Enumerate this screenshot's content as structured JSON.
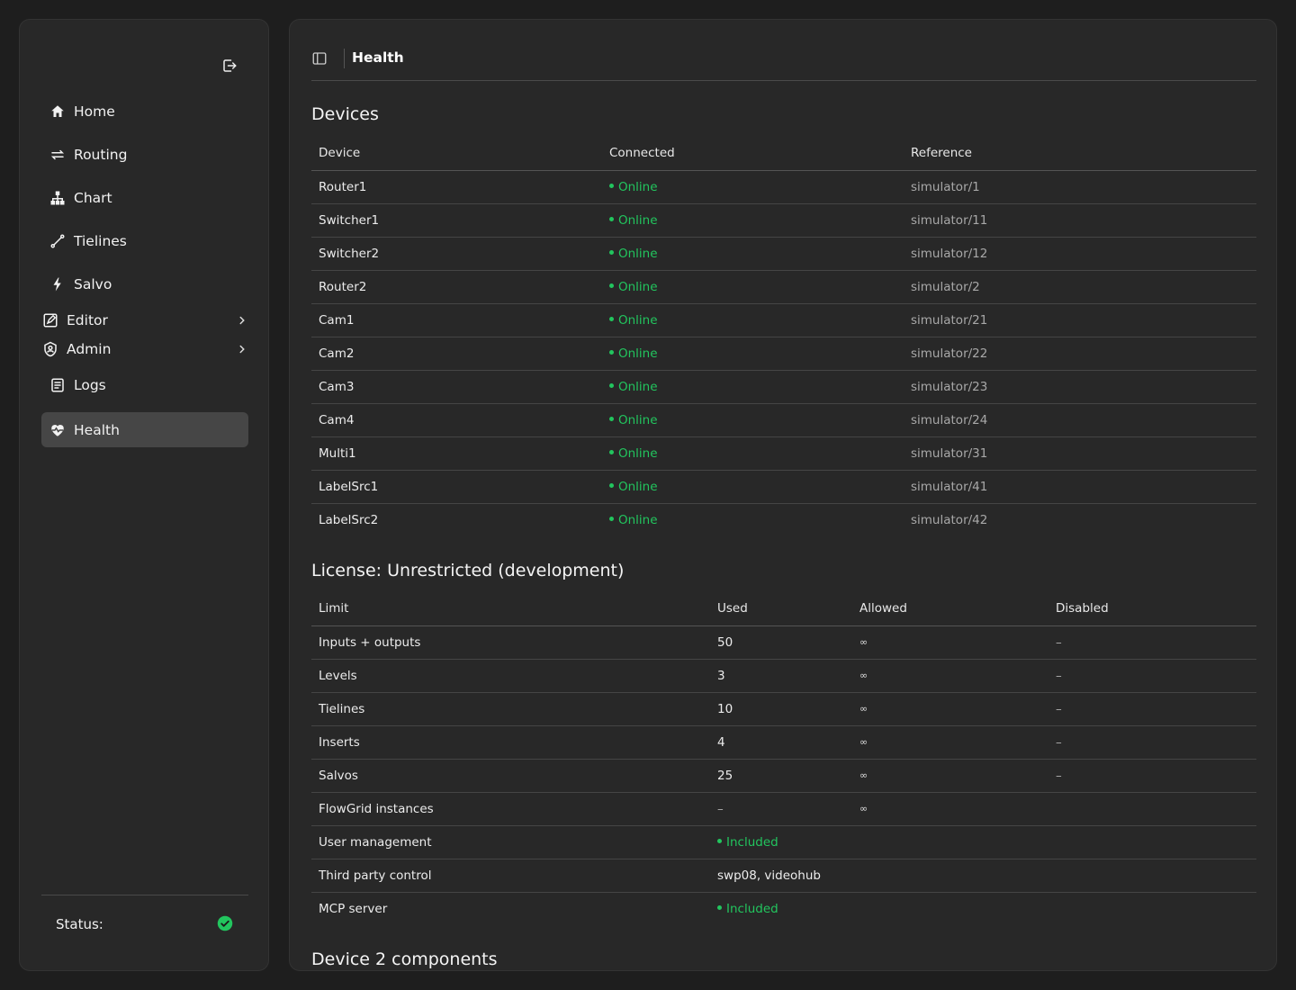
{
  "sidebar": {
    "items": [
      {
        "label": "Home",
        "icon": "home-icon"
      },
      {
        "label": "Routing",
        "icon": "arrows-icon"
      },
      {
        "label": "Chart",
        "icon": "hierarchy-icon"
      },
      {
        "label": "Tielines",
        "icon": "link-icon"
      },
      {
        "label": "Salvo",
        "icon": "lightning-icon"
      },
      {
        "label": "Editor",
        "icon": "edit-icon"
      },
      {
        "label": "Admin",
        "icon": "shield-icon"
      },
      {
        "label": "Logs",
        "icon": "list-icon"
      },
      {
        "label": "Health",
        "icon": "heart-pulse-icon"
      }
    ],
    "active": "Health",
    "status_label": "Status:",
    "status_color": "#22c55e"
  },
  "header": {
    "title": "Health"
  },
  "devices": {
    "title": "Devices",
    "columns": [
      "Device",
      "Connected",
      "Reference"
    ],
    "rows": [
      {
        "device": "Router1",
        "connected": "Online",
        "reference": "simulator/1"
      },
      {
        "device": "Switcher1",
        "connected": "Online",
        "reference": "simulator/11"
      },
      {
        "device": "Switcher2",
        "connected": "Online",
        "reference": "simulator/12"
      },
      {
        "device": "Router2",
        "connected": "Online",
        "reference": "simulator/2"
      },
      {
        "device": "Cam1",
        "connected": "Online",
        "reference": "simulator/21"
      },
      {
        "device": "Cam2",
        "connected": "Online",
        "reference": "simulator/22"
      },
      {
        "device": "Cam3",
        "connected": "Online",
        "reference": "simulator/23"
      },
      {
        "device": "Cam4",
        "connected": "Online",
        "reference": "simulator/24"
      },
      {
        "device": "Multi1",
        "connected": "Online",
        "reference": "simulator/31"
      },
      {
        "device": "LabelSrc1",
        "connected": "Online",
        "reference": "simulator/41"
      },
      {
        "device": "LabelSrc2",
        "connected": "Online",
        "reference": "simulator/42"
      }
    ]
  },
  "license": {
    "title": "License: Unrestricted (development)",
    "columns": [
      "Limit",
      "Used",
      "Allowed",
      "Disabled"
    ],
    "rows": [
      {
        "limit": "Inputs + outputs",
        "used": "50",
        "allowed": "∞",
        "disabled": "–"
      },
      {
        "limit": "Levels",
        "used": "3",
        "allowed": "∞",
        "disabled": "–"
      },
      {
        "limit": "Tielines",
        "used": "10",
        "allowed": "∞",
        "disabled": "–"
      },
      {
        "limit": "Inserts",
        "used": "4",
        "allowed": "∞",
        "disabled": "–"
      },
      {
        "limit": "Salvos",
        "used": "25",
        "allowed": "∞",
        "disabled": "–"
      },
      {
        "limit": "FlowGrid instances",
        "used": "–",
        "allowed": "∞",
        "disabled": ""
      },
      {
        "limit": "User management",
        "used": "Included",
        "used_type": "included",
        "allowed": "",
        "disabled": ""
      },
      {
        "limit": "Third party control",
        "used": "swp08, videohub",
        "allowed": "",
        "disabled": ""
      },
      {
        "limit": "MCP server",
        "used": "Included",
        "used_type": "included",
        "allowed": "",
        "disabled": ""
      }
    ]
  },
  "components": {
    "title": "Device 2 components"
  }
}
